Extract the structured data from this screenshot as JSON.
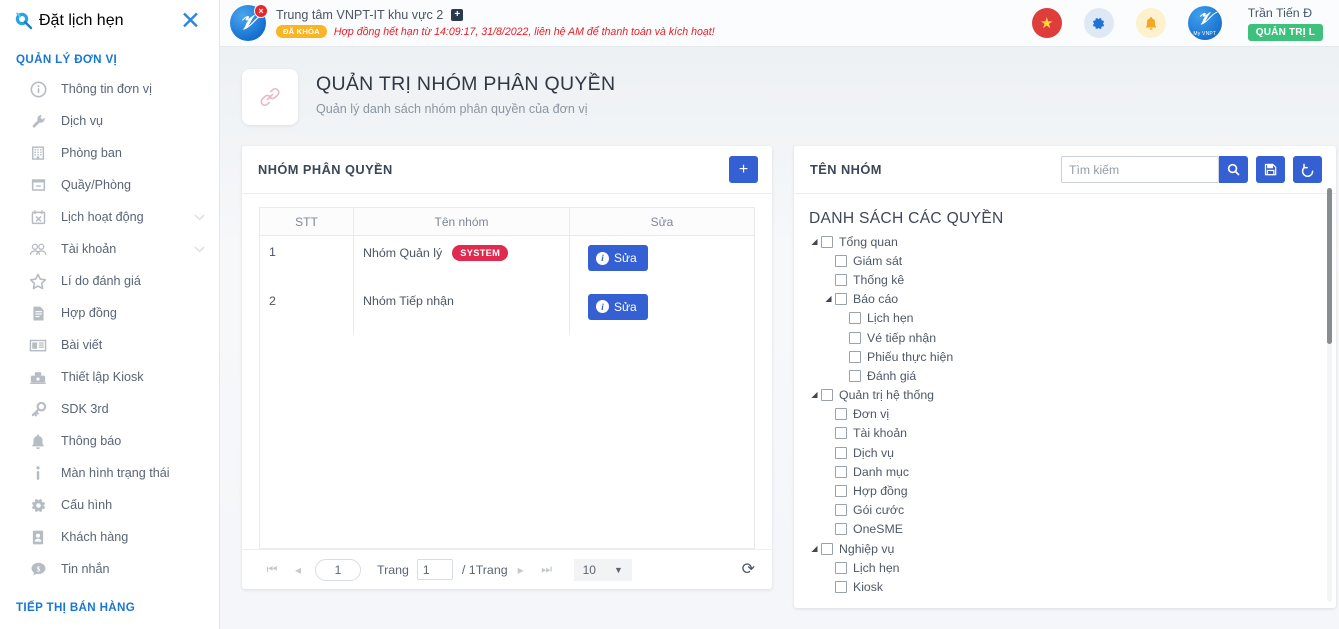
{
  "sidebar": {
    "brand": "Đặt lịch hẹn",
    "close_icon": "close-icon",
    "section_title": "QUẢN LÝ ĐƠN VỊ",
    "footer_section_title": "TIẾP THỊ BÁN HÀNG",
    "items": [
      {
        "label": "Thông tin đơn vị",
        "icon": "info-circle-icon",
        "chevron": false
      },
      {
        "label": "Dịch vụ",
        "icon": "wrench-icon",
        "chevron": false
      },
      {
        "label": "Phòng ban",
        "icon": "building-icon",
        "chevron": false
      },
      {
        "label": "Quầy/Phòng",
        "icon": "drawer-icon",
        "chevron": false
      },
      {
        "label": "Lịch hoạt động",
        "icon": "calendar-icon",
        "chevron": true
      },
      {
        "label": "Tài khoản",
        "icon": "users-icon",
        "chevron": true
      },
      {
        "label": "Lí do đánh giá",
        "icon": "star-icon",
        "chevron": false
      },
      {
        "label": "Hợp đồng",
        "icon": "document-icon",
        "chevron": false
      },
      {
        "label": "Bài viết",
        "icon": "article-icon",
        "chevron": false
      },
      {
        "label": "Thiết lập Kiosk",
        "icon": "kiosk-icon",
        "chevron": false
      },
      {
        "label": "SDK 3rd",
        "icon": "key-icon",
        "chevron": false
      },
      {
        "label": "Thông báo",
        "icon": "bell-icon",
        "chevron": false
      },
      {
        "label": "Màn hình trạng thái",
        "icon": "info-line-icon",
        "chevron": false
      },
      {
        "label": "Cấu hình",
        "icon": "gear-icon",
        "chevron": false
      },
      {
        "label": "Khách hàng",
        "icon": "contact-icon",
        "chevron": false
      },
      {
        "label": "Tin nhắn",
        "icon": "message-icon",
        "chevron": false
      }
    ]
  },
  "topbar": {
    "logo_badge": "×",
    "org_name": "Trung tâm VNPT-IT khu vực 2",
    "org_add_icon": "plus-square-icon",
    "lock_badge": "ĐÃ KHÓA",
    "warning": "Hợp đồng hết hạn từ 14:09:17, 31/8/2022, liên hệ AM để thanh toán và kích hoạt!",
    "icons": [
      {
        "name": "flag-icon",
        "glyph": "★"
      },
      {
        "name": "gear-icon",
        "glyph": "⚙"
      },
      {
        "name": "bell-icon",
        "glyph": "🔔"
      }
    ],
    "myvnpt_label": "My VNPT",
    "user_name": "Trần Tiến Đ",
    "user_role": "QUẢN TRỊ L"
  },
  "page": {
    "icon": "link-icon",
    "title": "QUẢN TRỊ NHÓM PHÂN QUYỀN",
    "subtitle": "Quản lý danh sách nhóm phân quyền của đơn vị"
  },
  "left_panel": {
    "title": "NHÓM PHÂN QUYỀN",
    "add_button": "+",
    "columns": [
      "STT",
      "Tên nhóm",
      "Sửa"
    ],
    "rows": [
      {
        "stt": "1",
        "name": "Nhóm Quản lý",
        "badge": "SYSTEM",
        "action": "Sửa"
      },
      {
        "stt": "2",
        "name": "Nhóm Tiếp nhận",
        "badge": "",
        "action": "Sửa"
      }
    ],
    "pager": {
      "first_icon": "first-page-icon",
      "prev_icon": "prev-page-icon",
      "current_page": "1",
      "page_label": "Trang",
      "page_input_value": "1",
      "total_label": "/ 1Trang",
      "next_icon": "next-page-icon",
      "last_icon": "last-page-icon",
      "page_size": "10",
      "refresh_icon": "refresh-icon"
    }
  },
  "right_panel": {
    "title": "TÊN NHÓM",
    "search_placeholder": "Tìm kiếm",
    "search_value": "",
    "buttons": [
      {
        "name": "search-button",
        "icon": "search-icon"
      },
      {
        "name": "save-button",
        "icon": "save-icon"
      },
      {
        "name": "reset-button",
        "icon": "undo-icon"
      }
    ],
    "tree_title": "DANH SÁCH CÁC QUYỀN",
    "tree": [
      {
        "label": "Tổng quan",
        "indent": 0,
        "toggle": true,
        "checked": false
      },
      {
        "label": "Giám sát",
        "indent": 1,
        "toggle": false,
        "checked": false
      },
      {
        "label": "Thống kê",
        "indent": 1,
        "toggle": false,
        "checked": false
      },
      {
        "label": "Báo cáo",
        "indent": 1,
        "toggle": true,
        "checked": false
      },
      {
        "label": "Lịch hẹn",
        "indent": 2,
        "toggle": false,
        "checked": false
      },
      {
        "label": "Vé tiếp nhận",
        "indent": 2,
        "toggle": false,
        "checked": false
      },
      {
        "label": "Phiếu thực hiện",
        "indent": 2,
        "toggle": false,
        "checked": false
      },
      {
        "label": "Đánh giá",
        "indent": 2,
        "toggle": false,
        "checked": false
      },
      {
        "label": "Quản trị hệ thống",
        "indent": 0,
        "toggle": true,
        "checked": false
      },
      {
        "label": "Đơn vị",
        "indent": 1,
        "toggle": false,
        "checked": false
      },
      {
        "label": "Tài khoản",
        "indent": 1,
        "toggle": false,
        "checked": false
      },
      {
        "label": "Dịch vụ",
        "indent": 1,
        "toggle": false,
        "checked": false
      },
      {
        "label": "Danh mục",
        "indent": 1,
        "toggle": false,
        "checked": false
      },
      {
        "label": "Hợp đồng",
        "indent": 1,
        "toggle": false,
        "checked": false
      },
      {
        "label": "Gói cước",
        "indent": 1,
        "toggle": false,
        "checked": false
      },
      {
        "label": "OneSME",
        "indent": 1,
        "toggle": false,
        "checked": false
      },
      {
        "label": "Nghiệp vụ",
        "indent": 0,
        "toggle": true,
        "checked": false
      },
      {
        "label": "Lịch hẹn",
        "indent": 1,
        "toggle": false,
        "checked": false
      },
      {
        "label": "Kiosk",
        "indent": 1,
        "toggle": false,
        "checked": false
      }
    ]
  },
  "colors": {
    "brand_blue": "#1877d2",
    "primary_button": "#3460d4",
    "badge_system": "#e02a50",
    "lock_badge": "#fab527",
    "warning_text": "#ec1c24",
    "role_green": "#3ec17c"
  }
}
